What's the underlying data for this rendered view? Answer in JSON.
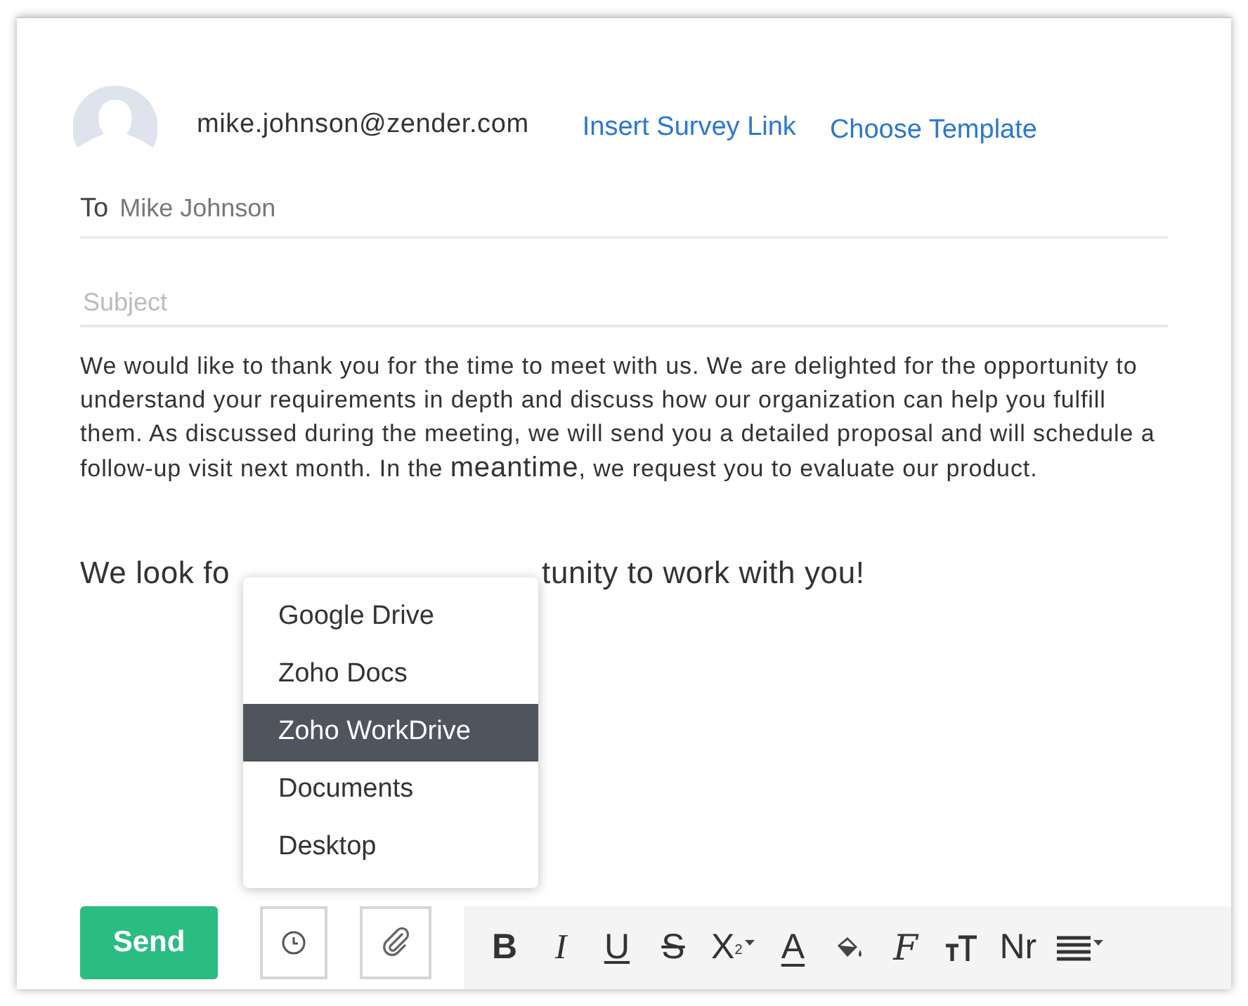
{
  "sender": {
    "email": "mike.johnson@zender.com"
  },
  "links": [
    "Insert Survey Link",
    "Choose Template"
  ],
  "to": {
    "label": "To",
    "value": "Mike Johnson"
  },
  "subject": {
    "placeholder": "Subject"
  },
  "body": [
    {
      "kind": "paragraph",
      "segments": [
        {
          "text": "We would like to thank you for the time to meet with us. We are delighted for the opportunity to understand your requirements in depth and discuss how our organization can help you fulfill them. As discussed during the meeting, we will send you a detailed proposal and will schedule a follow-up visit next month. In the ",
          "large": false
        },
        {
          "text": "meantime",
          "large": true
        },
        {
          "text": ", we request you to evaluate our product.",
          "large": false
        }
      ]
    },
    {
      "kind": "covered",
      "before": "We look fo",
      "after": "tunity to work with you!"
    }
  ],
  "attach_menu": [
    {
      "label": "Google Drive",
      "selected": false
    },
    {
      "label": "Zoho Docs",
      "selected": false
    },
    {
      "label": "Zoho WorkDrive",
      "selected": true
    },
    {
      "label": "Documents",
      "selected": false
    },
    {
      "label": "Desktop",
      "selected": false
    }
  ],
  "send_button": "Send",
  "toolbar": [
    {
      "kind": "bold",
      "label": "B"
    },
    {
      "kind": "italic",
      "label": "I"
    },
    {
      "kind": "underline",
      "label": "U"
    },
    {
      "kind": "strike",
      "label": "S"
    },
    {
      "kind": "subscript",
      "label": "X",
      "sub": "2"
    },
    {
      "kind": "color",
      "label": "A"
    },
    {
      "kind": "fill"
    },
    {
      "kind": "font",
      "label": "F"
    },
    {
      "kind": "size"
    },
    {
      "kind": "normal",
      "label": "Nr"
    },
    {
      "kind": "align"
    }
  ]
}
